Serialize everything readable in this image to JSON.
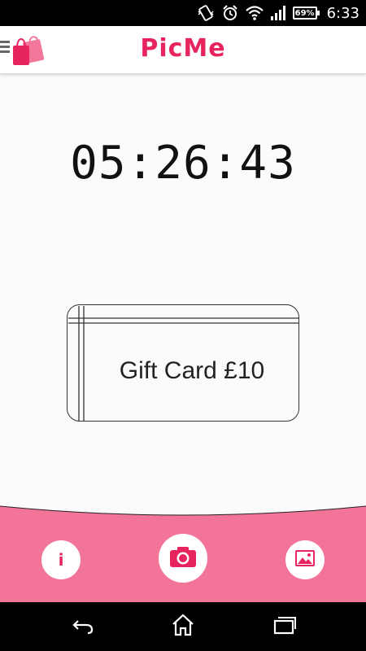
{
  "status_bar": {
    "time": "6:33",
    "battery_percent": "69%",
    "icons": [
      "vibrate-icon",
      "alarm-icon",
      "wifi-icon",
      "signal-icon",
      "battery-icon"
    ]
  },
  "app_bar": {
    "title": "PicMe",
    "menu_icon": "hamburger-icon",
    "logo_icon": "shopping-bags-icon",
    "brand_color": "#e8245f"
  },
  "timer": {
    "value": "05:26:43"
  },
  "gift_card": {
    "label": "Gift Card £10"
  },
  "bottom_bar": {
    "background_color": "#f27499",
    "actions": [
      {
        "name": "info",
        "icon": "info-icon",
        "glyph": "i"
      },
      {
        "name": "camera",
        "icon": "camera-icon"
      },
      {
        "name": "gallery",
        "icon": "image-icon"
      }
    ]
  },
  "nav_bar": {
    "buttons": [
      "back-icon",
      "home-icon",
      "recents-icon"
    ]
  }
}
